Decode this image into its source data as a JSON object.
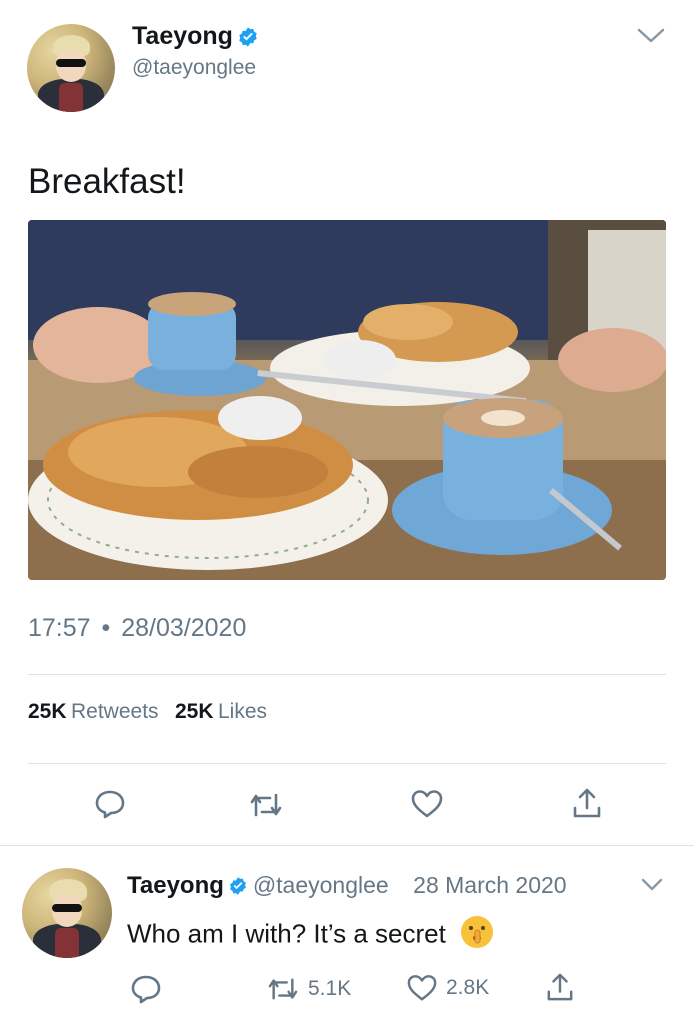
{
  "tweet": {
    "name": "Taeyong",
    "handle": "@taeyonglee",
    "text": "Breakfast!",
    "time": "17:57",
    "separator": "•",
    "date": "28/03/2020",
    "retweets_count": "25K",
    "retweets_label": "Retweets",
    "likes_count": "25K",
    "likes_label": "Likes"
  },
  "reply": {
    "name": "Taeyong",
    "handle": "@taeyonglee",
    "date": "28 March 2020",
    "text": "Who am I with? It’s a secret",
    "retweet_count": "5.1K",
    "like_count": "2.8K"
  },
  "icons": {
    "verified": "verified-badge-icon",
    "caret": "chevron-down-icon",
    "reply": "reply-icon",
    "retweet": "retweet-icon",
    "like": "heart-icon",
    "share": "share-icon",
    "emoji": "shushing-face-emoji"
  },
  "colors": {
    "verified": "#1DA1F2",
    "icon_gray": "#657786",
    "text": "#14171a",
    "divider": "#dfe3e6"
  }
}
